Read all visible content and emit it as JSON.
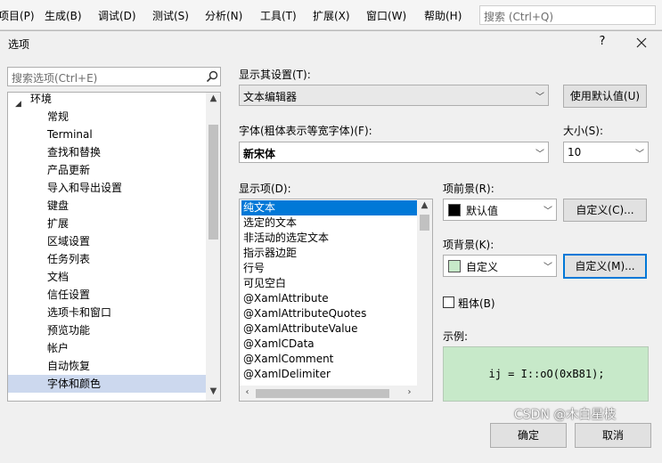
{
  "menubar": {
    "items": [
      "项目(P)",
      "生成(B)",
      "调试(D)",
      "测试(S)",
      "分析(N)",
      "工具(T)",
      "扩展(X)",
      "窗口(W)",
      "帮助(H)"
    ],
    "search_placeholder": "搜索 (Ctrl+Q)"
  },
  "dialog": {
    "title": "选项",
    "help": "?",
    "search_placeholder": "搜索选项(Ctrl+E)",
    "tree": {
      "items": [
        "环境",
        "常规",
        "Terminal",
        "查找和替换",
        "产品更新",
        "导入和导出设置",
        "键盘",
        "扩展",
        "区域设置",
        "任务列表",
        "文档",
        "信任设置",
        "选项卡和窗口",
        "预览功能",
        "帐户",
        "自动恢复",
        "字体和颜色"
      ],
      "selected": "字体和颜色"
    },
    "show_settings_for_label": "显示其设置(T):",
    "show_settings_for_value": "文本编辑器",
    "use_defaults_button": "使用默认值(U)",
    "font_label": "字体(粗体表示等宽字体)(F):",
    "font_value": "新宋体",
    "size_label": "大小(S):",
    "size_value": "10",
    "display_items_label": "显示项(D):",
    "display_items": [
      "纯文本",
      "选定的文本",
      "非活动的选定文本",
      "指示器边距",
      "行号",
      "可见空白",
      "@XamlAttribute",
      "@XamlAttributeQuotes",
      "@XamlAttributeValue",
      "@XamlCData",
      "@XamlComment",
      "@XamlDelimiter"
    ],
    "selected_display_item": "纯文本",
    "foreground_label": "项前景(R):",
    "foreground_value": "默认值",
    "foreground_color": "#000000",
    "background_label": "项背景(K):",
    "background_value": "自定义",
    "background_color": "#c7e9c9",
    "custom_button": "自定义(C)...",
    "custom_button_2": "自定义(M)...",
    "bold_label": "粗体(B)",
    "sample_label": "示例:",
    "sample_text": "ij = I::oO(0xB81);",
    "ok_button": "确定",
    "cancel_button": "取消"
  },
  "watermark": "CSDN @木白星枝",
  "colors": {
    "selection": "#0078d7",
    "tree_selection": "#ccd8ee"
  }
}
